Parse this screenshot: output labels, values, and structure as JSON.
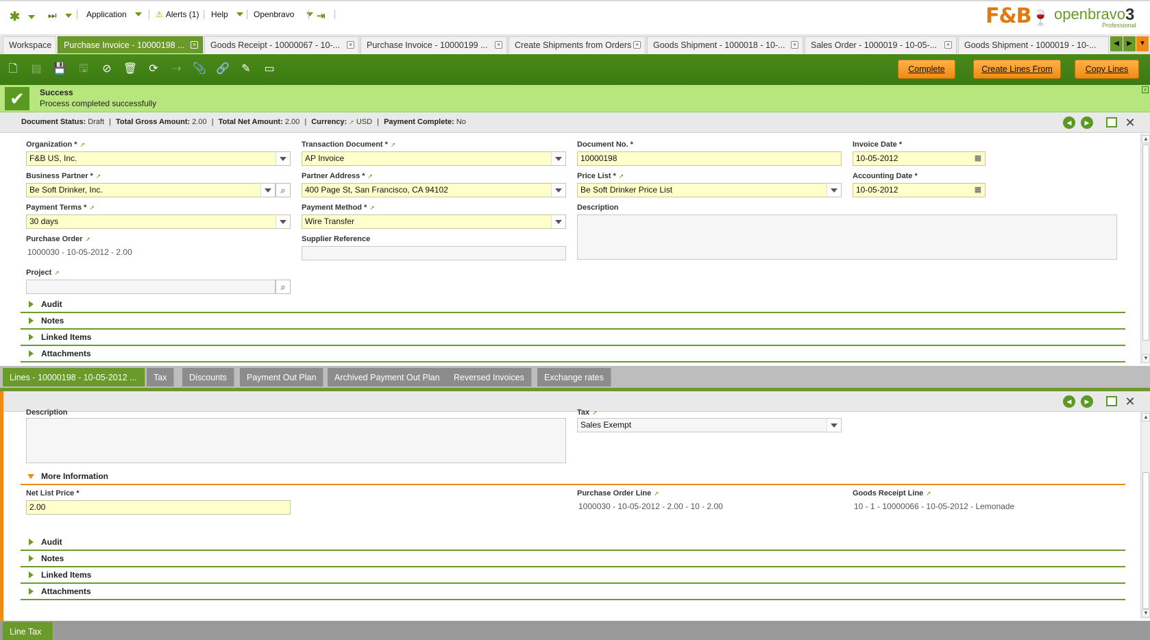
{
  "nav": {
    "application": "Application",
    "alerts": "Alerts (1)",
    "help": "Help",
    "user": "Openbravo",
    "brand_fb": "F&B",
    "brand_ob": "openbravo",
    "brand_version": "3",
    "brand_edition": "Professional"
  },
  "tabs": [
    {
      "label": "Workspace"
    },
    {
      "label": "Purchase Invoice - 10000198 ..."
    },
    {
      "label": "Goods Receipt - 10000067 - 10-..."
    },
    {
      "label": "Purchase Invoice - 10000199 ..."
    },
    {
      "label": "Create Shipments from Orders"
    },
    {
      "label": "Goods Shipment - 1000018 - 10-..."
    },
    {
      "label": "Sales Order - 1000019 - 10-05-..."
    },
    {
      "label": "Goods Shipment - 1000019 - 10-..."
    }
  ],
  "toolbar": {
    "complete": "Complete",
    "create_lines_from": "Create Lines From",
    "copy_lines": "Copy Lines"
  },
  "message": {
    "title": "Success",
    "text": "Process completed successfully"
  },
  "status": {
    "doc_status_label": "Document Status:",
    "doc_status": "Draft",
    "gross_label": "Total Gross Amount:",
    "gross": "2.00",
    "net_label": "Total Net Amount:",
    "net": "2.00",
    "currency_label": "Currency:",
    "currency": "USD",
    "paid_label": "Payment Complete:",
    "paid": "No",
    "sep": "|"
  },
  "header_form": {
    "organization_label": "Organization *",
    "organization": "F&B US, Inc.",
    "transaction_document_label": "Transaction Document *",
    "transaction_document": "AP Invoice",
    "document_no_label": "Document No. *",
    "document_no": "10000198",
    "invoice_date_label": "Invoice Date *",
    "invoice_date": "10-05-2012",
    "business_partner_label": "Business Partner *",
    "business_partner": "Be Soft Drinker, Inc.",
    "partner_address_label": "Partner Address *",
    "partner_address": "400 Page St, San Francisco, CA 94102",
    "price_list_label": "Price List *",
    "price_list": "Be Soft Drinker Price List",
    "accounting_date_label": "Accounting Date *",
    "accounting_date": "10-05-2012",
    "payment_terms_label": "Payment Terms *",
    "payment_terms": "30 days",
    "payment_method_label": "Payment Method *",
    "payment_method": "Wire Transfer",
    "description_label": "Description",
    "purchase_order_label": "Purchase Order",
    "purchase_order": "1000030 - 10-05-2012 - 2.00",
    "supplier_reference_label": "Supplier Reference",
    "project_label": "Project"
  },
  "sections": {
    "audit": "Audit",
    "notes": "Notes",
    "linked_items": "Linked Items",
    "attachments": "Attachments",
    "more_information": "More Information"
  },
  "subtabs": [
    {
      "label": "Lines - 10000198 - 10-05-2012 ..."
    },
    {
      "label": "Tax"
    },
    {
      "label": "Discounts"
    },
    {
      "label": "Payment Out Plan"
    },
    {
      "label": "Archived Payment Out Plan"
    },
    {
      "label": "Reversed Invoices"
    },
    {
      "label": "Exchange rates"
    }
  ],
  "lines_form": {
    "description_label": "Description",
    "tax_label": "Tax",
    "tax": "Sales Exempt",
    "net_list_price_label": "Net List Price *",
    "net_list_price": "2.00",
    "purchase_order_line_label": "Purchase Order Line",
    "purchase_order_line": "1000030 - 10-05-2012 - 2.00 - 10 - 2.00",
    "goods_receipt_line_label": "Goods Receipt Line",
    "goods_receipt_line": "10 - 1 - 10000066 - 10-05-2012 - Lemonade"
  },
  "bottom_tab": {
    "label": "Line Tax"
  },
  "colors": {
    "accent": "#6a9a2a",
    "orange": "#f08a10",
    "required_bg": "#ffffcc",
    "success_bg": "#b8e67e"
  }
}
